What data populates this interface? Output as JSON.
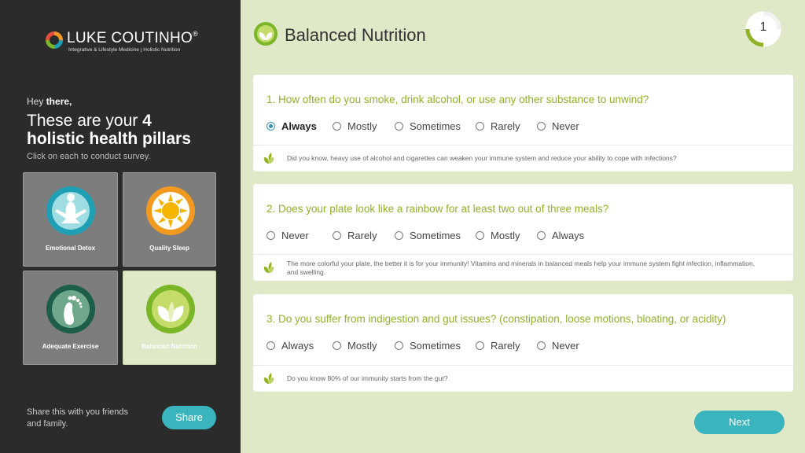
{
  "brand": {
    "name": "LUKE COUTINHO",
    "registered": "®",
    "tagline": "Integrative & Lifestyle Medicine | Holistic Nutrition"
  },
  "sidebar": {
    "greeting_prefix": "Hey",
    "greeting_name": "there,",
    "headline_line1_prefix": "These are your",
    "headline_number": "4",
    "headline_line2": "holistic health pillars",
    "subtext": "Click on each to conduct survey.",
    "pillars": [
      {
        "label": "Emotional Detox",
        "icon": "meditation-icon"
      },
      {
        "label": "Quality Sleep",
        "icon": "sun-icon"
      },
      {
        "label": "Adequate Exercise",
        "icon": "footprint-icon"
      },
      {
        "label": "Balanced Nutrition",
        "icon": "leaf-icon",
        "active": true
      }
    ],
    "share_text": "Share this with you friends and family.",
    "share_button": "Share"
  },
  "main": {
    "title": "Balanced Nutrition",
    "step": "1",
    "next_button": "Next",
    "questions": [
      {
        "text": "1. How often do you smoke, drink alcohol, or use any other substance to unwind?",
        "options": [
          "Always",
          "Mostly",
          "Sometimes",
          "Rarely",
          "Never"
        ],
        "selected": "Always",
        "tip": "Did you know, heavy use of alcohol and cigarettes can weaken your immune system and reduce your ability to cope with infections?"
      },
      {
        "text": "2. Does your plate look like a rainbow for at least two out of three meals?",
        "options": [
          "Never",
          "Rarely",
          "Sometimes",
          "Mostly",
          "Always"
        ],
        "selected": "",
        "tip": "The more colorful your plate, the better it is for your immunity! Vitamins and minerals in balanced meals help your immune system fight infection, inflammation, and swelling."
      },
      {
        "text": "3. Do you suffer from indigestion and gut issues? (constipation, loose motions, bloating, or acidity)",
        "options": [
          "Always",
          "Mostly",
          "Sometimes",
          "Rarely",
          "Never"
        ],
        "selected": "",
        "tip": "Do you know 80% of our immunity starts from the gut?"
      }
    ]
  },
  "colors": {
    "sidebar_bg": "#2b2b2b",
    "main_bg": "#dfe9c8",
    "accent_green": "#8fb226",
    "button_teal": "#3ab5bd"
  }
}
